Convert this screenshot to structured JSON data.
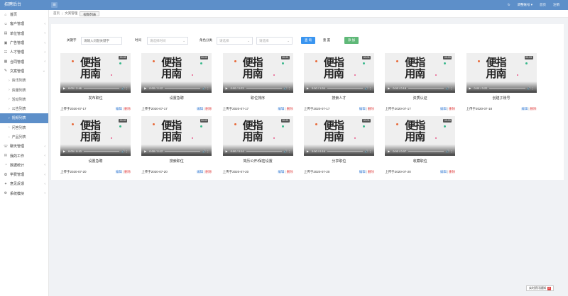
{
  "header": {
    "brand": "招聘后台",
    "collapse_icon": "☰",
    "refresh_icon": "↻",
    "user": "调整账号",
    "user_chevron": "▾",
    "home": "首页",
    "logout": "注销"
  },
  "sidebar": {
    "items": [
      {
        "icon": "⌂",
        "label": "首页",
        "chev": ""
      },
      {
        "icon": "☺",
        "label": "客户管理",
        "chev": "‹"
      },
      {
        "icon": "▤",
        "label": "单位管理",
        "chev": "‹"
      },
      {
        "icon": "▣",
        "label": "广告管理",
        "chev": "‹"
      },
      {
        "icon": "☷",
        "label": "人才管理",
        "chev": "‹"
      },
      {
        "icon": "▦",
        "label": "合同管理",
        "chev": "‹"
      },
      {
        "icon": "✎",
        "label": "文案管理",
        "chev": "⌄"
      }
    ],
    "subitems": [
      "资讯列表",
      "资服列表",
      "活动列表",
      "公告列表",
      "视频列表",
      "问答列表",
      "产品列表"
    ],
    "items_after": [
      {
        "icon": "☏",
        "label": "聊天管理",
        "chev": "‹"
      },
      {
        "icon": "✉",
        "label": "我的工作",
        "chev": "‹"
      },
      {
        "icon": "◔",
        "label": "数据统计",
        "chev": "‹"
      },
      {
        "icon": "✿",
        "label": "学费管理",
        "chev": "‹"
      },
      {
        "icon": "✦",
        "label": "意见反馈",
        "chev": "‹"
      },
      {
        "icon": "⚙",
        "label": "系统模块",
        "chev": "‹"
      }
    ]
  },
  "breadcrumb": {
    "home": "首页",
    "sep": "/",
    "level1": "文案管理",
    "current": "视频列表"
  },
  "filters": {
    "keyword_label": "关键字",
    "keyword_placeholder": "请输入问题关键字",
    "time_label": "时间",
    "time_placeholder": "请选择时间",
    "role_label": "角色分类",
    "role_placeholder": "请选择",
    "sub_placeholder": "请选择",
    "select_caret": "⌄",
    "query_btn": "查 询",
    "reset_btn": "重 置",
    "add_btn": "添 加"
  },
  "video_overlay": {
    "logo_line1": "便指",
    "logo_line2": "用南",
    "badge": "00:03",
    "play_icon": "▶",
    "volume_icon": "🔊",
    "more_icon": "⋮"
  },
  "cards": [
    {
      "title": "发布职位",
      "time": "0:00 / 2:46",
      "date": "上传于2020-07-17"
    },
    {
      "title": "设置急聘",
      "time": "0:00 / 0:12",
      "date": "上传于2020-07-17"
    },
    {
      "title": "职位排序",
      "time": "0:00 / 0:23",
      "date": "上传于2020-07-17"
    },
    {
      "title": "搜索人才",
      "time": "0:00 / 1:54",
      "date": "上传于2020-07-17"
    },
    {
      "title": "资质认证",
      "time": "0:00 / 0:18",
      "date": "上传于2020-07-17"
    },
    {
      "title": "创建子账号",
      "time": "0:00 / 0:22",
      "date": "上传于2020-07-18"
    },
    {
      "title": "设置急聘",
      "time": "0:00 / 0:10",
      "date": "上传于2020-07-20"
    },
    {
      "title": "搜索职位",
      "time": "0:00 / 0:12",
      "date": "上传于2020-07-20"
    },
    {
      "title": "简历公开/保密设置",
      "time": "0:00 / 0:14",
      "date": "上传于2020-07-20"
    },
    {
      "title": "分享职位",
      "time": "0:00 / 0:16",
      "date": "上传于2020-07-20"
    },
    {
      "title": "收藏职位",
      "time": "0:00 / 0:07",
      "date": "上传于2020-07-20"
    }
  ],
  "card_actions": {
    "edit": "编辑",
    "pipe": "|",
    "delete": "删除"
  },
  "float": {
    "label": "实时资讯通知",
    "close": "✕"
  }
}
